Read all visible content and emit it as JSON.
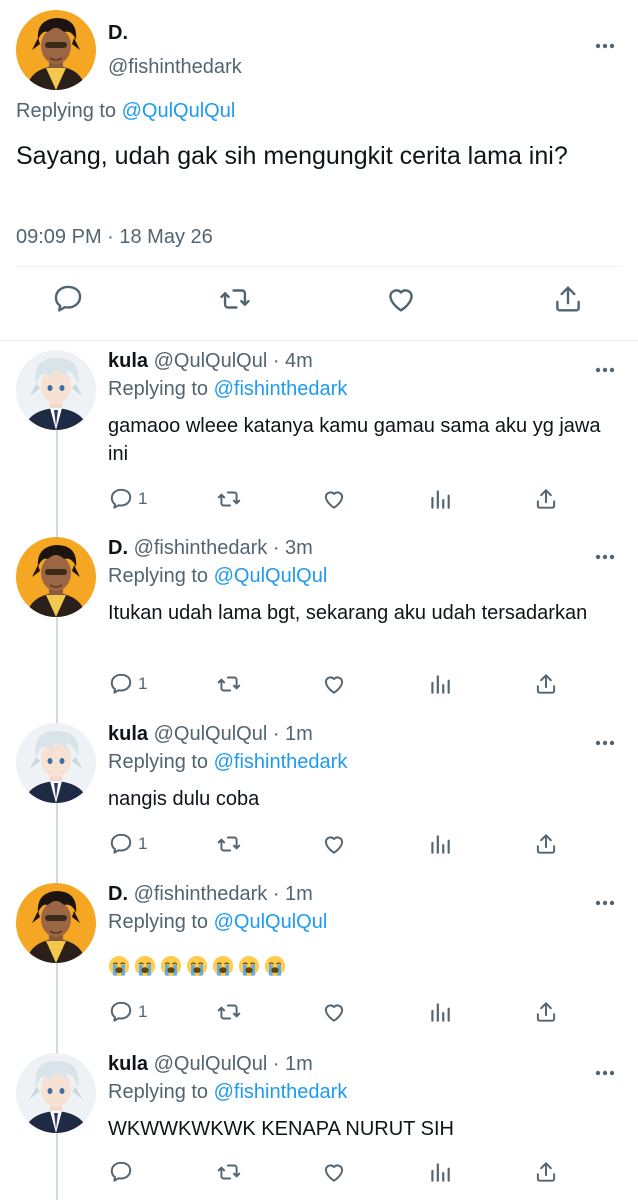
{
  "main_tweet": {
    "name": "D.",
    "handle": "@fishinthedark",
    "replying_prefix": "Replying to ",
    "replying_handle": "@QulQulQul",
    "text": "Sayang, udah gak sih mengungkit cerita lama ini?",
    "timestamp": "09:09 PM · 18 May 26"
  },
  "replies": [
    {
      "name": "kula",
      "handle": "@QulQulQul",
      "sep": " · ",
      "time": "4m",
      "replying_prefix": "Replying to ",
      "replying_handle": "@fishinthedark",
      "text": "gamaoo wleee katanya kamu gamau sama aku yg jawa ini",
      "reply_count": "1"
    },
    {
      "name": "D.",
      "handle": "@fishinthedark",
      "sep": " · ",
      "time": "3m",
      "replying_prefix": "Replying to ",
      "replying_handle": "@QulQulQul",
      "text": "Itukan udah lama bgt, sekarang aku udah tersadarkan",
      "reply_count": "1"
    },
    {
      "name": "kula",
      "handle": "@QulQulQul",
      "sep": " · ",
      "time": "1m",
      "replying_prefix": "Replying to ",
      "replying_handle": "@fishinthedark",
      "text": "nangis dulu coba",
      "reply_count": "1"
    },
    {
      "name": "D.",
      "handle": "@fishinthedark",
      "sep": " · ",
      "time": "1m",
      "replying_prefix": "Replying to ",
      "replying_handle": "@QulQulQul",
      "emoji_name": "loudly-crying-face",
      "emoji_count": 7,
      "reply_count": "1"
    },
    {
      "name": "kula",
      "handle": "@QulQulQul",
      "sep": " · ",
      "time": "1m",
      "replying_prefix": "Replying to ",
      "replying_handle": "@fishinthedark",
      "text": "WKWWKWKWK KENAPA NURUT SIH"
    }
  ],
  "colors": {
    "accent": "#1d9bf0",
    "secondary_text": "#536471",
    "primary_text": "#0f1419",
    "separator": "#eff3f4"
  },
  "icons": [
    "reply-icon",
    "retweet-icon",
    "like-icon",
    "share-icon",
    "analytics-icon",
    "more-icon"
  ]
}
